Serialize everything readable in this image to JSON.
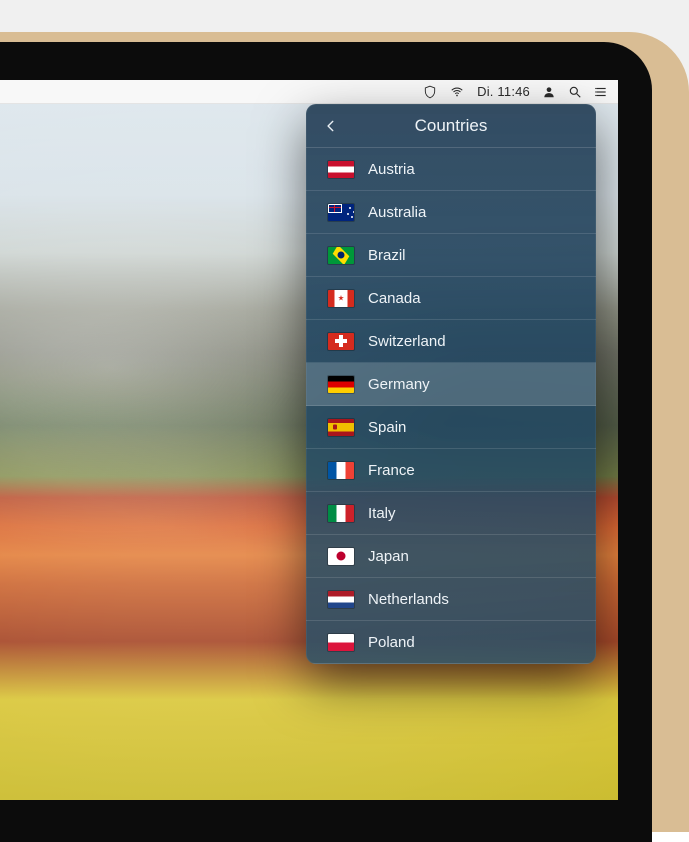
{
  "menubar": {
    "clock": "Di. 11:46"
  },
  "panel": {
    "title": "Countries",
    "countries": [
      {
        "code": "at",
        "name": "Austria",
        "selected": false
      },
      {
        "code": "au",
        "name": "Australia",
        "selected": false
      },
      {
        "code": "br",
        "name": "Brazil",
        "selected": false
      },
      {
        "code": "ca",
        "name": "Canada",
        "selected": false
      },
      {
        "code": "ch",
        "name": "Switzerland",
        "selected": false
      },
      {
        "code": "de",
        "name": "Germany",
        "selected": true
      },
      {
        "code": "es",
        "name": "Spain",
        "selected": false
      },
      {
        "code": "fr",
        "name": "France",
        "selected": false
      },
      {
        "code": "it",
        "name": "Italy",
        "selected": false
      },
      {
        "code": "jp",
        "name": "Japan",
        "selected": false
      },
      {
        "code": "nl",
        "name": "Netherlands",
        "selected": false
      },
      {
        "code": "pl",
        "name": "Poland",
        "selected": false
      }
    ]
  }
}
